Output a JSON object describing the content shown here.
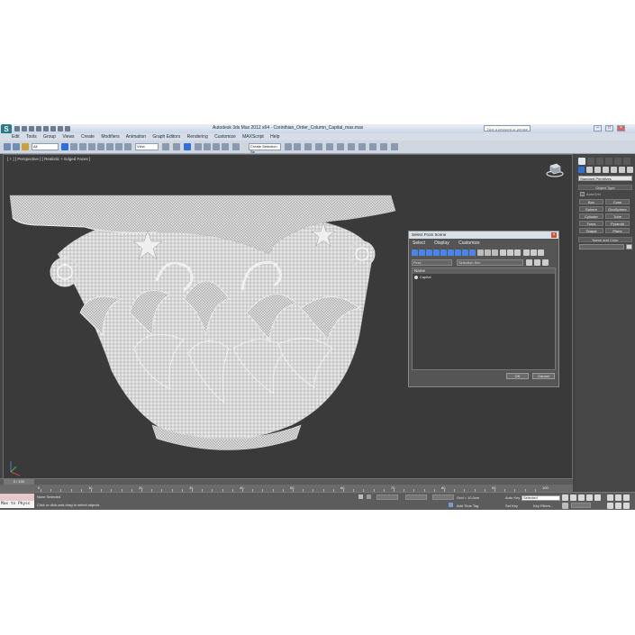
{
  "window": {
    "logo": "S",
    "title": "Autodesk 3ds Max 2012 x64 · Corinthian_Order_Column_Capital_max.max",
    "help_search": "Type a keyword or phrase",
    "min": "–",
    "max": "□",
    "close": "×"
  },
  "menubar": {
    "items": [
      "Edit",
      "Tools",
      "Group",
      "Views",
      "Create",
      "Modifiers",
      "Animation",
      "Graph Editors",
      "Rendering",
      "Customize",
      "MAXScript",
      "Help"
    ]
  },
  "toolbar": {
    "selection_filter": "All",
    "reference_coord": "View",
    "named_selection": "Create Selection Se"
  },
  "viewport": {
    "label": "[ + ] [ Perspective ] [ Realistic + Edged Faces ]",
    "frame_counter": "0 / 100"
  },
  "command_panel": {
    "dropdown": "Standard Primitives",
    "object_type_header": "Object Type",
    "autogrid": "AutoGrid",
    "primitives": [
      "Box",
      "Cone",
      "Sphere",
      "GeoSphere",
      "Cylinder",
      "Tube",
      "Torus",
      "Pyramid",
      "Teapot",
      "Plane"
    ],
    "name_color_header": "Name and Color"
  },
  "dialog": {
    "title": "Select From Scene",
    "close": "×",
    "menu": [
      "Select",
      "Display",
      "Customize"
    ],
    "find_label": "Find:",
    "selection_set_label": "Selection Set:",
    "column_header": "Name",
    "rows": [
      "Capital"
    ],
    "ok": "OK",
    "cancel": "Cancel"
  },
  "timeline": {
    "thumb": "0 / 100",
    "ticks": [
      "0",
      "10",
      "20",
      "30",
      "40",
      "50",
      "60",
      "70",
      "80",
      "90",
      "100"
    ]
  },
  "status": {
    "maxscript_out": "Max to Physc",
    "selection_info": "None Selected",
    "prompt": "Click or click-and-drag to select objects",
    "grid": "Grid = 10,0cm",
    "auto_key": "Auto Key",
    "set_key": "Set Key",
    "key_mode": "Selected",
    "key_filters": "Key Filters...",
    "add_time_tag": "Add Time Tag"
  },
  "colors": {
    "accent_blue": "#2f6fd6",
    "viewport_bg": "#3a3a3a",
    "mesh_wire": "#f2f2f2"
  }
}
